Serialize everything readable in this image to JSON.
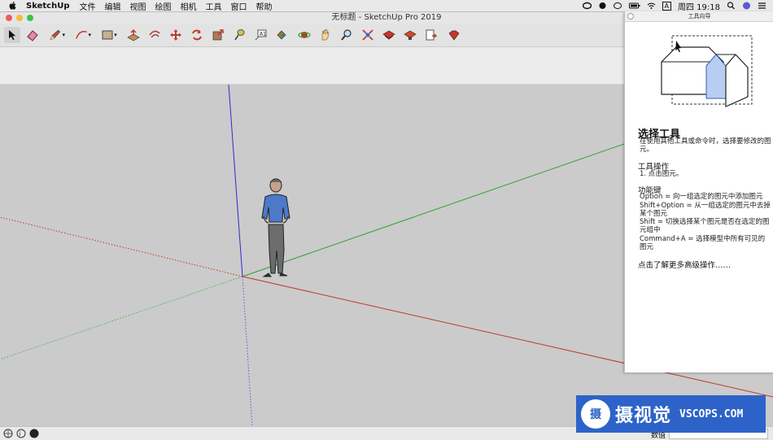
{
  "menubar": {
    "app_name": "SketchUp",
    "items": [
      "文件",
      "编辑",
      "视图",
      "绘图",
      "相机",
      "工具",
      "窗口",
      "帮助"
    ],
    "clock": "周四 19:18",
    "input_method": "A"
  },
  "window": {
    "title": "无标题 - SketchUp Pro 2019"
  },
  "toolbar": {
    "tools": [
      {
        "icon": "select-arrow-icon"
      },
      {
        "icon": "eraser-icon"
      },
      {
        "icon": "pencil-icon"
      },
      {
        "icon": "arc-icon"
      },
      {
        "icon": "rectangle-icon"
      },
      {
        "icon": "push-pull-icon"
      },
      {
        "icon": "offset-icon"
      },
      {
        "icon": "move-icon"
      },
      {
        "icon": "rotate-icon"
      },
      {
        "icon": "scale-icon"
      },
      {
        "icon": "tape-measure-icon"
      },
      {
        "icon": "text-icon"
      },
      {
        "icon": "paint-bucket-icon"
      },
      {
        "icon": "orbit-icon"
      },
      {
        "icon": "pan-icon"
      },
      {
        "icon": "zoom-icon"
      },
      {
        "icon": "zoom-extents-icon"
      },
      {
        "icon": "3d-warehouse-icon"
      },
      {
        "icon": "extension-warehouse-icon"
      },
      {
        "icon": "send-to-layout-icon"
      },
      {
        "icon": "extension-manager-icon"
      }
    ]
  },
  "instructor": {
    "panel_title": "工具向导",
    "tool_name": "选择工具",
    "description": "在使用其他工具或命令时，选择要修改的图元。",
    "operation_heading": "工具操作",
    "operation_steps": "1. 点击图元。",
    "keys_heading": "功能键",
    "keys": [
      "Option = 向一组选定的图元中添加图元",
      "Shift+Option = 从一组选定的图元中去掉某个图元",
      "Shift = 切换选择某个图元是否在选定的图元组中",
      "Command+A = 选择模型中所有可见的图元"
    ],
    "advanced_link": "点击了解更多高级操作……"
  },
  "statusbar": {
    "measurements_label": "数值"
  },
  "watermark": {
    "logo_char": "摄",
    "cn_text": "摄视觉",
    "en_text": "VSCOPS.COM"
  },
  "colors": {
    "red_axis": "#c0392b",
    "green_axis": "#2fa12f",
    "blue_axis": "#2b2bd0",
    "watermark_bg": "#2d63c8"
  }
}
